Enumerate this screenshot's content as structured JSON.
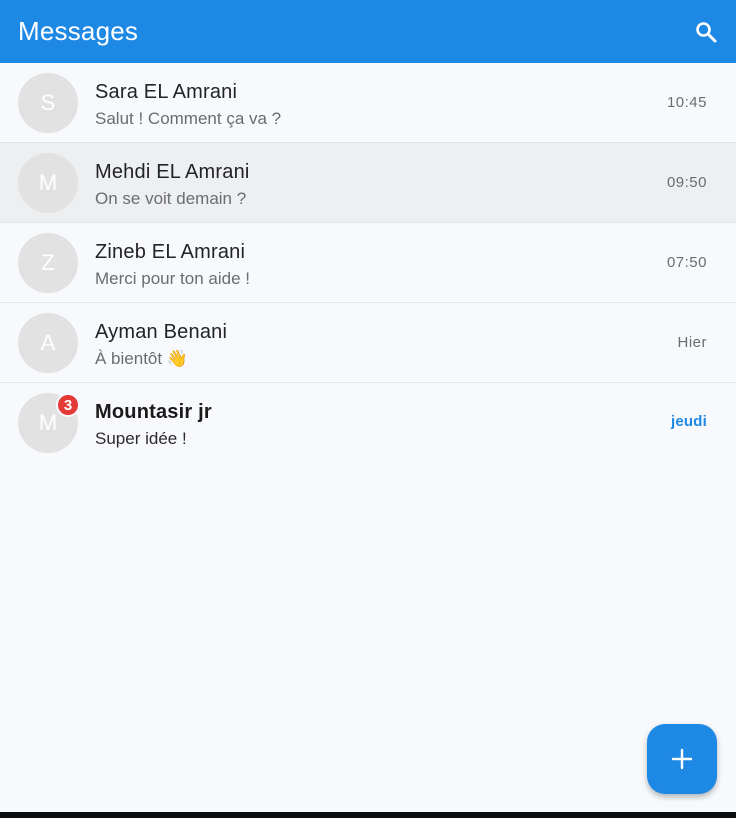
{
  "header": {
    "title": "Messages",
    "search_icon": "search-icon"
  },
  "conversations": [
    {
      "initial": "S",
      "name": "Sara EL Amrani",
      "preview": "Salut ! Comment ça va ?",
      "time": "10:45"
    },
    {
      "initial": "M",
      "name": "Mehdi EL Amrani",
      "preview": "On se voit demain ?",
      "time": "09:50"
    },
    {
      "initial": "Z",
      "name": "Zineb EL Amrani",
      "preview": "Merci pour ton aide !",
      "time": "07:50"
    },
    {
      "initial": "A",
      "name": "Ayman Benani",
      "preview": "À bientôt 👋",
      "time": "Hier"
    },
    {
      "initial": "M",
      "name": "Mountasir jr",
      "preview": "Super idée !",
      "time": "jeudi",
      "unread_count": "3"
    }
  ],
  "fab": {
    "icon": "plus-icon"
  },
  "colors": {
    "primary": "#1e88e5",
    "badge": "#e53935",
    "avatar": "#e2e2e2",
    "background": "#f7f9fd"
  }
}
